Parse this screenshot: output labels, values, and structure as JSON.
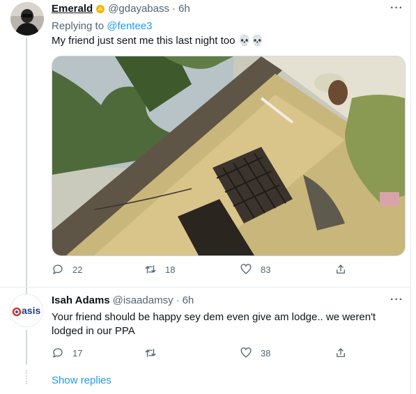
{
  "tweet1": {
    "display_name": "Emerald",
    "handle": "@gdayabass",
    "separator": "·",
    "time": "6h",
    "replying_label": "Replying to",
    "replying_handle": "@fentee3",
    "text": "My friend just sent me this last night too",
    "emoji": "💀💀",
    "actions": {
      "replies": "22",
      "retweets": "18",
      "likes": "83"
    }
  },
  "tweet2": {
    "display_name": "Isah Adams",
    "handle": "@isaadamsy",
    "separator": "·",
    "time": "6h",
    "avatar_text": "asis",
    "text": "Your friend should be happy sey dem even give am lodge.. we weren't lodged in our PPA",
    "actions": {
      "replies": "17",
      "retweets": "",
      "likes": "38"
    }
  },
  "show_replies": "Show replies",
  "more_glyph": "···",
  "colors": {
    "accent": "#1d9bf0",
    "secondary": "#536471",
    "emoji_badge": "#f4b400"
  }
}
